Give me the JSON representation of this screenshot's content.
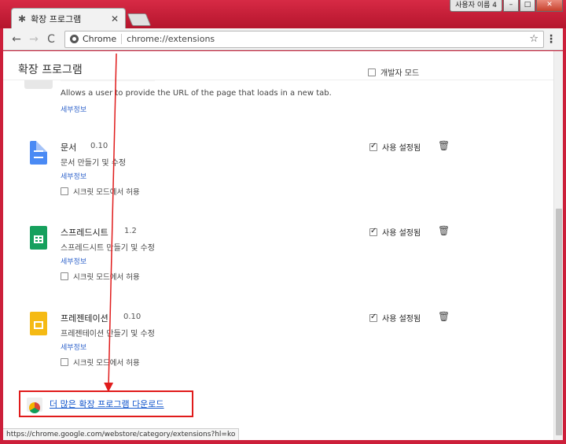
{
  "window": {
    "user_label": "사용자 이름 4",
    "minimize": "–",
    "maximize": "□",
    "close": "✕"
  },
  "tab": {
    "title": "확장 프로그램",
    "close": "✕"
  },
  "toolbar": {
    "back": "←",
    "forward": "→",
    "reload": "C",
    "site_label": "Chrome",
    "url": "chrome://extensions",
    "star": "☆",
    "menu": "⋮"
  },
  "page": {
    "title": "확장 프로그램",
    "developer_mode_label": "개발자 모드",
    "developer_mode_checked": false
  },
  "partial_extension": {
    "description": "Allows a user to provide the URL of the page that loads in a new tab.",
    "details_label": "세부정보"
  },
  "extensions": [
    {
      "name": "문서",
      "version": "0.10",
      "description": "문서 만들기 및 수정",
      "details_label": "세부정보",
      "incognito_label": "시크릿 모드에서 허용",
      "enabled_label": "사용 설정됨",
      "icon": "docs-icon"
    },
    {
      "name": "스프레드시트",
      "version": "1.2",
      "description": "스프레드시트 만들기 및 수정",
      "details_label": "세부정보",
      "incognito_label": "시크릿 모드에서 허용",
      "enabled_label": "사용 설정됨",
      "icon": "sheets-icon"
    },
    {
      "name": "프레젠테이션",
      "version": "0.10",
      "description": "프레젠테이션 만들기 및 수정",
      "details_label": "세부정보",
      "incognito_label": "시크릿 모드에서 허용",
      "enabled_label": "사용 설정됨",
      "icon": "slides-icon"
    }
  ],
  "more_extensions": {
    "label": "더 많은 확장 프로그램 다운로드"
  },
  "status_bar": {
    "url": "https://chrome.google.com/webstore/category/extensions?hl=ko"
  },
  "colors": {
    "frame": "#cc1f3a",
    "link": "#3366cc",
    "highlight": "#e01b1b"
  }
}
